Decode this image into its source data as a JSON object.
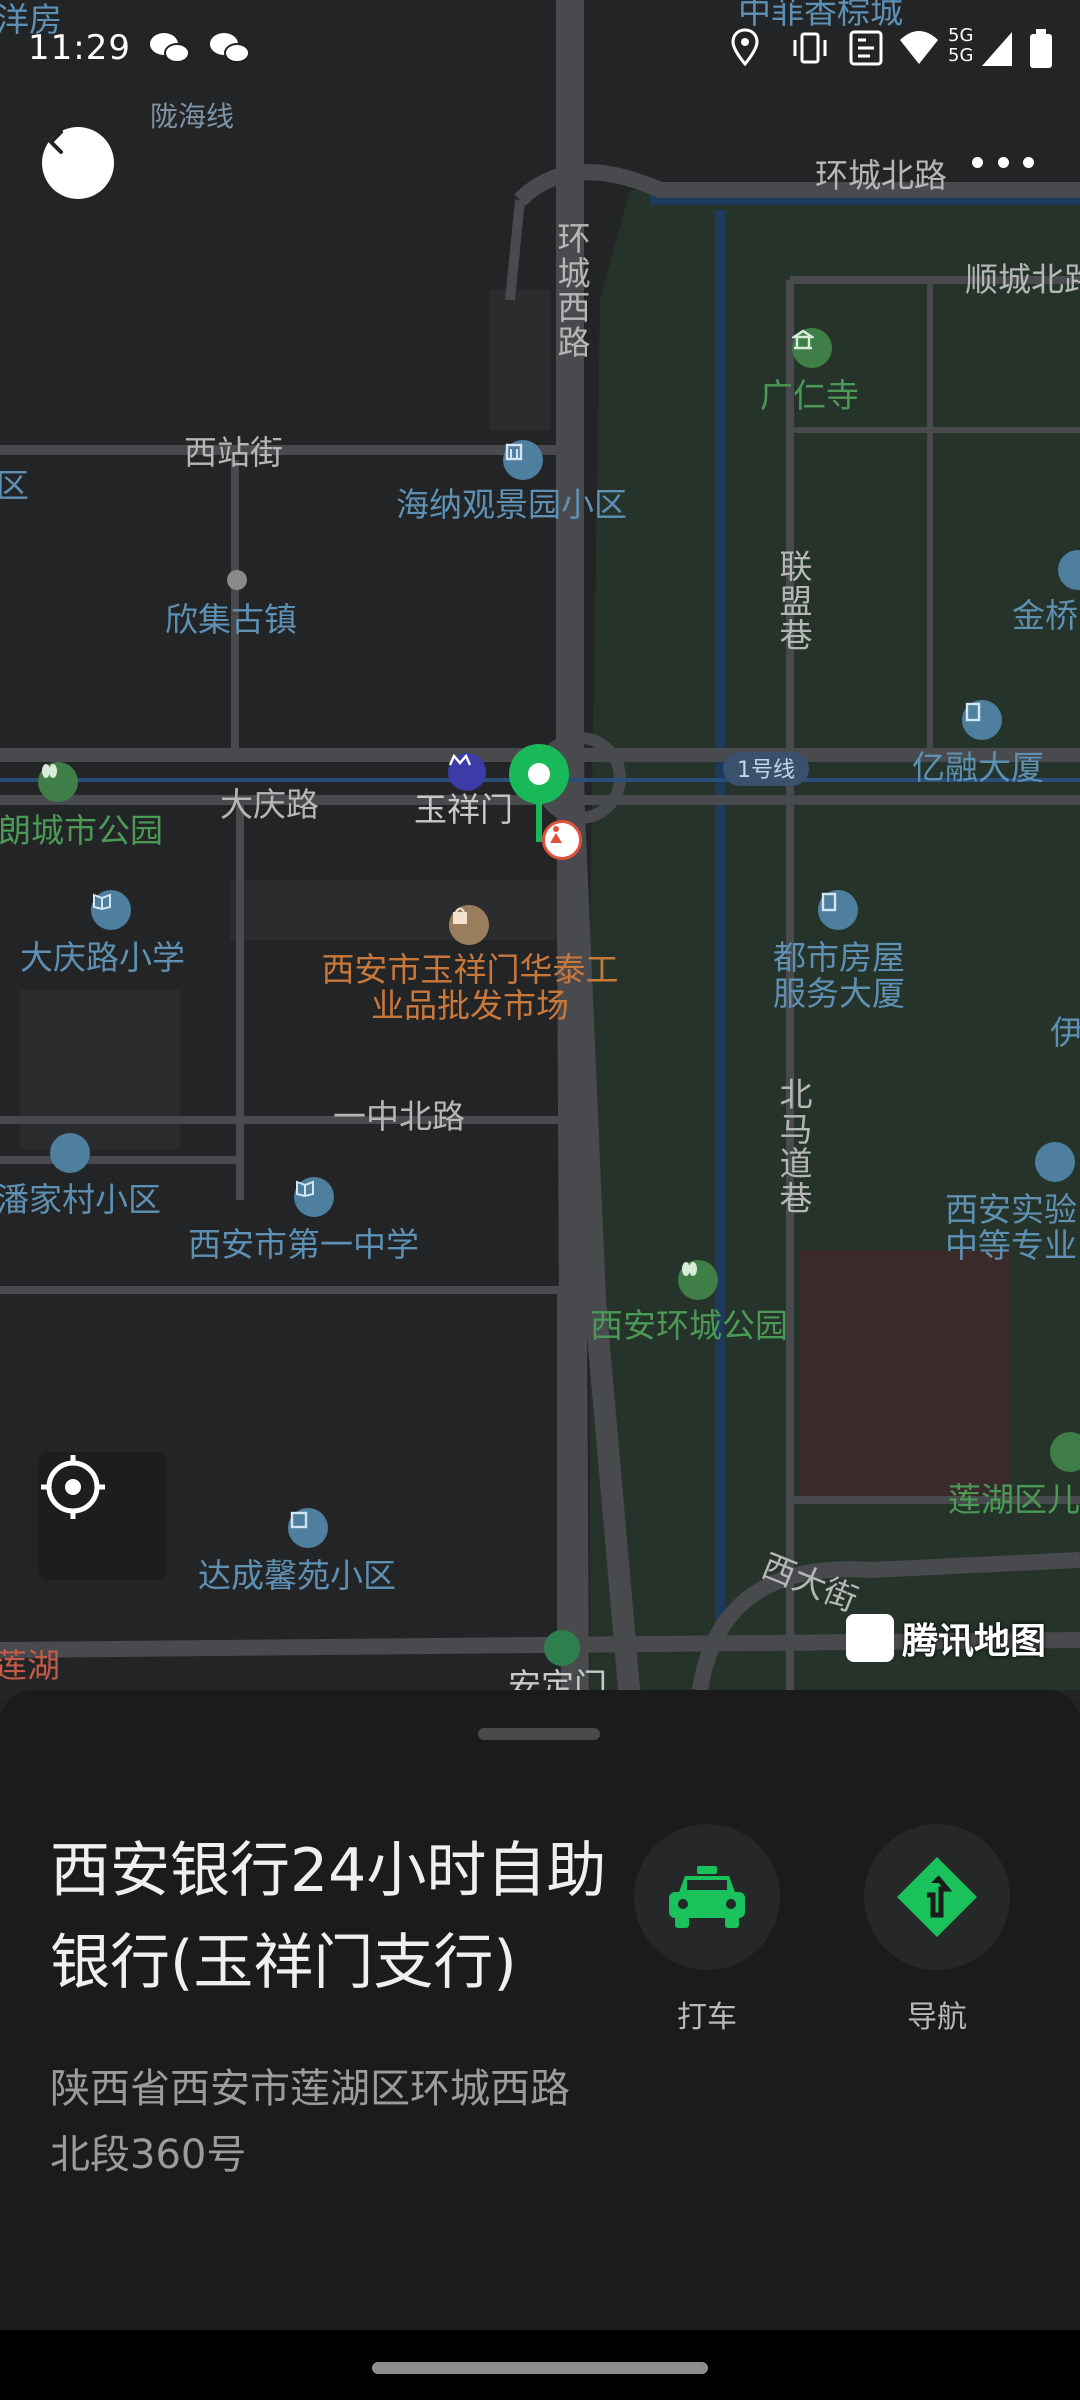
{
  "status_bar": {
    "time": "11:29",
    "icons": [
      "wechat-icon",
      "wechat-icon",
      "location-icon",
      "vibrate-icon",
      "nfc-icon",
      "wifi-icon",
      "signal-5g-icon",
      "battery-icon"
    ],
    "network": "5G"
  },
  "map": {
    "roads": [
      {
        "name": "环城北路"
      },
      {
        "name": "顺城北路"
      },
      {
        "name": "环城西路"
      },
      {
        "name": "西站街"
      },
      {
        "name": "大庆路"
      },
      {
        "name": "一中北路"
      },
      {
        "name": "联盟巷"
      },
      {
        "name": "北马道巷"
      },
      {
        "name": "西大街"
      },
      {
        "name": "陇海线"
      },
      {
        "name": "1号线"
      }
    ],
    "pois": [
      {
        "name": "广仁寺",
        "color": "green"
      },
      {
        "name": "海纳观景园小区",
        "color": "blue"
      },
      {
        "name": "欣集古镇",
        "color": "blue"
      },
      {
        "name": "金桥",
        "color": "blue"
      },
      {
        "name": "亿融大厦",
        "color": "blue"
      },
      {
        "name": "玉祥门",
        "color": "road"
      },
      {
        "name": "朗城市公园",
        "color": "green"
      },
      {
        "name": "大庆路小学",
        "color": "blue"
      },
      {
        "name": "西安市玉祥门华泰工业品批发市场",
        "color": "orange"
      },
      {
        "name": "都市房屋服务大厦",
        "color": "blue"
      },
      {
        "name": "伊",
        "color": "blue"
      },
      {
        "name": "潘家村小区",
        "color": "blue"
      },
      {
        "name": "西安市第一中学",
        "color": "blue"
      },
      {
        "name": "西安实验中等专业",
        "color": "blue"
      },
      {
        "name": "西安环城公园",
        "color": "green"
      },
      {
        "name": "莲湖区儿",
        "color": "green"
      },
      {
        "name": "达成馨苑小区",
        "color": "blue"
      },
      {
        "name": "安定门",
        "color": "road"
      },
      {
        "name": "莲湖",
        "color": "red"
      },
      {
        "name": "洋房",
        "color": "blue"
      },
      {
        "name": "中菲香棕城",
        "color": "blue"
      },
      {
        "name": "区",
        "color": "blue"
      }
    ],
    "logo_text": "腾讯地图",
    "colors": {
      "marker": "#19b95a",
      "water": "#1d3a5c",
      "park": "#25332a",
      "road": "#484a4d"
    }
  },
  "place": {
    "name": "西安银行24小时自助银行(玉祥门支行)",
    "address": "陕西省西安市莲湖区环城西路北段360号"
  },
  "actions": [
    {
      "label": "打车",
      "icon": "taxi-icon",
      "color": "#19c25a"
    },
    {
      "label": "导航",
      "icon": "navigation-icon",
      "color": "#19c25a"
    }
  ]
}
